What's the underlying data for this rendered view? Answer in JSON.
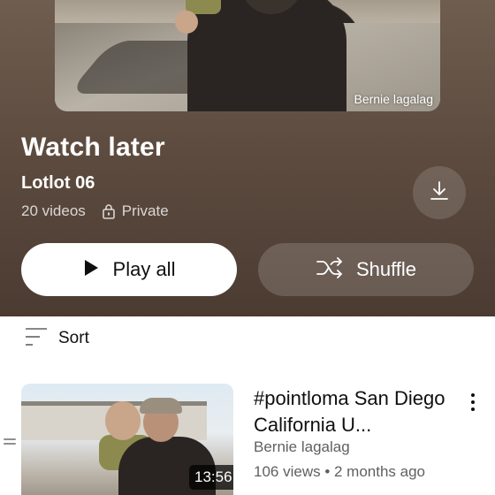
{
  "playlist": {
    "cover_credit": "Bernie lagalag",
    "title": "Watch later",
    "owner": "Lotlot 06",
    "video_count": "20 videos",
    "privacy": "Private"
  },
  "actions": {
    "play_all": "Play all",
    "shuffle": "Shuffle"
  },
  "sort": {
    "label": "Sort"
  },
  "videos": [
    {
      "title": "#pointloma    San Diego California U...",
      "channel": "Bernie lagalag",
      "stats": "106 views • 2 months ago",
      "duration": "13:56"
    }
  ],
  "icons": {
    "download": "download-icon",
    "lock": "lock-icon",
    "play": "play-icon",
    "shuffle": "shuffle-icon",
    "sort": "sort-icon",
    "more": "more-vert-icon",
    "drag": "drag-handle-icon"
  }
}
